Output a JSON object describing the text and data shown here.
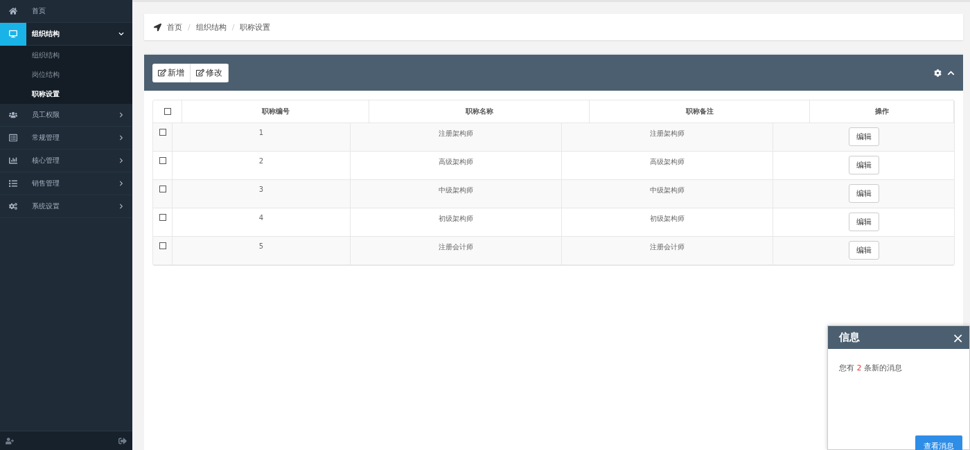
{
  "sidebar": {
    "items": [
      {
        "kind": "link",
        "label": "首页",
        "selected": false
      },
      {
        "kind": "menu",
        "label": "组织结构",
        "selected": true,
        "expanded": true,
        "children": [
          {
            "label": "组织结构",
            "selected": false
          },
          {
            "label": "岗位结构",
            "selected": false
          },
          {
            "label": "职称设置",
            "selected": true
          }
        ]
      },
      {
        "kind": "menu",
        "label": "员工权限",
        "selected": false,
        "expanded": false
      },
      {
        "kind": "menu",
        "label": "常规管理",
        "selected": false,
        "expanded": false
      },
      {
        "kind": "menu",
        "label": "核心管理",
        "selected": false,
        "expanded": false
      },
      {
        "kind": "menu",
        "label": "销售管理",
        "selected": false,
        "expanded": false
      },
      {
        "kind": "menu",
        "label": "系统设置",
        "selected": false,
        "expanded": false
      }
    ]
  },
  "breadcrumb": {
    "separator": "/",
    "items": [
      "首页",
      "组织结构",
      "职称设置"
    ]
  },
  "toolbar": {
    "buttons": [
      "新增",
      "修改"
    ]
  },
  "table": {
    "header_checked": false,
    "columns": [
      "职称编号",
      "职称名称",
      "职称备注",
      "操作"
    ],
    "rows": [
      {
        "checked": false,
        "cells": [
          "1",
          "注册架构师",
          "注册架构师"
        ],
        "action": "编辑"
      },
      {
        "checked": false,
        "cells": [
          "2",
          "高级架构师",
          "高级架构师"
        ],
        "action": "编辑"
      },
      {
        "checked": false,
        "cells": [
          "3",
          "中级架构师",
          "中级架构师"
        ],
        "action": "编辑"
      },
      {
        "checked": false,
        "cells": [
          "4",
          "初级架构师",
          "初级架构师"
        ],
        "action": "编辑"
      },
      {
        "checked": false,
        "cells": [
          "5",
          "注册会计师",
          "注册会计师"
        ],
        "action": "编辑"
      }
    ]
  },
  "notification": {
    "title": "信息",
    "close": "×",
    "message": {
      "prefix": "您有 ",
      "count": "2",
      "suffix": " 条新的消息"
    },
    "button": "查看消息"
  }
}
